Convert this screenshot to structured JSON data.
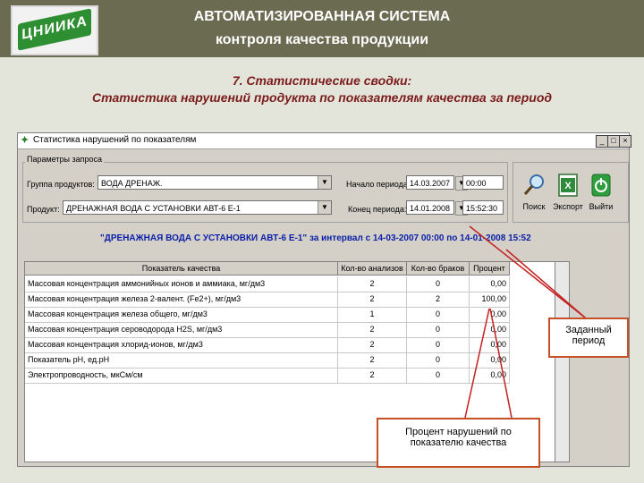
{
  "header": {
    "logo_text": "ЦНИИКА",
    "line1": "АВТОМАТИЗИРОВАННАЯ СИСТЕМА",
    "line2": "контроля качества продукции"
  },
  "subtitle": {
    "line1": "7. Статистические сводки:",
    "line2": "Статистика нарушений продукта по показателям качества за период"
  },
  "window": {
    "title": "Статистика нарушений по показателям",
    "params_label": "Параметры запроса",
    "group_label": "Группа продуктов:",
    "group_value": "ВОДА ДРЕНАЖ.",
    "product_label": "Продукт:",
    "product_value": "ДРЕНАЖНАЯ ВОДА С УСТАНОВКИ АВТ-6 Е-1",
    "start_label": "Начало периода:",
    "start_date": "14.03.2007",
    "start_time": "00:00",
    "end_label": "Конец периода:",
    "end_date": "14.01.2008",
    "end_time": "15:52:30",
    "buttons": {
      "search": "Поиск",
      "export": "Экспорт",
      "exit": "Выйти"
    },
    "summary": "\"ДРЕНАЖНАЯ ВОДА С УСТАНОВКИ АВТ-6 Е-1\" за интервал с 14-03-2007 00:00 по 14-01-2008 15:52"
  },
  "table": {
    "headers": [
      "Показатель качества",
      "Кол-во анализов",
      "Кол-во браков",
      "Процент"
    ],
    "rows": [
      [
        "Массовая концентрация аммонийных ионов и аммиака, мг/дм3",
        "2",
        "0",
        "0,00"
      ],
      [
        "Массовая концентрация железа 2-валент. (Fe2+), мг/дм3",
        "2",
        "2",
        "100,00"
      ],
      [
        "Массовая концентрация железа общего, мг/дм3",
        "1",
        "0",
        "0,00"
      ],
      [
        "Массовая концентрация сероводорода H2S, мг/дм3",
        "2",
        "0",
        "0,00"
      ],
      [
        "Массовая концентрация хлорид-ионов, мг/дм3",
        "2",
        "0",
        "0,00"
      ],
      [
        "Показатель pH, ед.pH",
        "2",
        "0",
        "0,00"
      ],
      [
        "Электропроводность, мкСм/см",
        "2",
        "0",
        "0,00"
      ]
    ]
  },
  "annotations": {
    "period": "Заданный период",
    "percent": "Процент нарушений по показателю качества"
  },
  "colors": {
    "topbar": "#6b6b52",
    "summary_text": "#0a1fa8",
    "annotation_border": "#c65028"
  }
}
